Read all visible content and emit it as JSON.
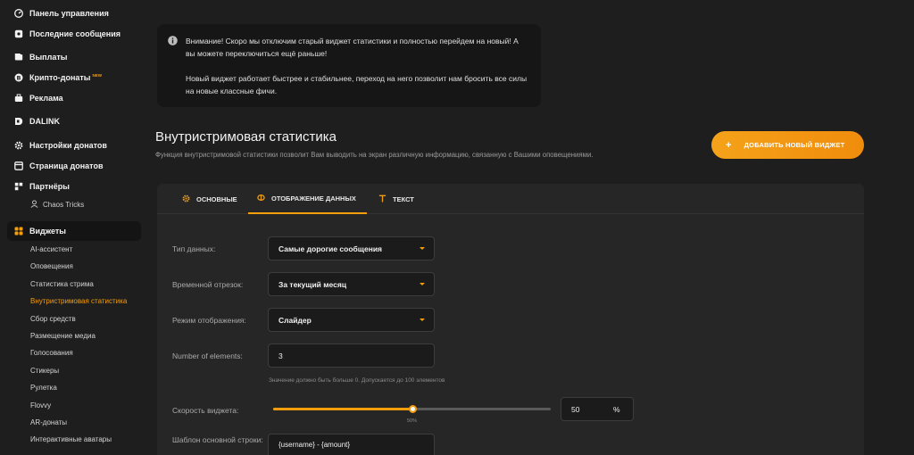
{
  "sidebar": {
    "items": [
      {
        "label": "Панель управления",
        "icon": "dashboard-icon"
      },
      {
        "label": "Последние сообщения",
        "icon": "messages-icon"
      },
      {
        "label": "Выплаты",
        "icon": "wallet-icon"
      },
      {
        "label": "Крипто-донаты",
        "icon": "bitcoin-icon",
        "badge": "NEW"
      },
      {
        "label": "Реклама",
        "icon": "briefcase-icon"
      },
      {
        "label": "DALINK",
        "icon": "dalink-icon"
      },
      {
        "label": "Настройки донатов",
        "icon": "gear-icon"
      },
      {
        "label": "Страница донатов",
        "icon": "page-icon"
      },
      {
        "label": "Партнёры",
        "icon": "partners-icon"
      },
      {
        "label": "Виджеты",
        "icon": "widgets-icon"
      }
    ],
    "partner_sub": "Chaos Tricks",
    "widget_subs": [
      "AI-ассистент",
      "Оповещения",
      "Статистика стрима",
      "Внутристримовая статистика",
      "Сбор средств",
      "Размещение медиа",
      "Голосования",
      "Стикеры",
      "Рулетка",
      "Flovvy",
      "AR-донаты",
      "Интерактивные аватары"
    ],
    "active_sub": "Внутристримовая статистика"
  },
  "notice": {
    "line1": "Внимание! Скоро мы отключим старый виджет статистики и полностью перейдем на новый! А вы можете переключиться ещё раньше!",
    "line2": "Новый виджет работает быстрее и стабильнее, переход на него позволит нам бросить все силы на новые классные фичи."
  },
  "page": {
    "title": "Внутристримовая статистика",
    "description": "Функция внутристримовой статистики позволит Вам выводить на экран различную информацию, связанную с Вашими оповещениями.",
    "add_button": "ДОБАВИТЬ НОВЫЙ ВИДЖЕТ"
  },
  "tabs": [
    {
      "label": "ОСНОВНЫЕ",
      "icon": "gear-icon"
    },
    {
      "label": "ОТОБРАЖЕНИЕ ДАННЫХ",
      "icon": "database-icon",
      "active": true
    },
    {
      "label": "ТЕКСТ",
      "icon": "text-icon"
    }
  ],
  "form": {
    "data_type_label": "Тип данных:",
    "data_type_value": "Самые дорогие сообщения",
    "period_label": "Временной отрезок:",
    "period_value": "За текущий месяц",
    "display_mode_label": "Режим отображения:",
    "display_mode_value": "Слайдер",
    "elements_label": "Number of elements:",
    "elements_value": "3",
    "elements_hint": "Значение должно быть больше 0. Допускается до 100 элементов",
    "speed_label": "Скорость виджета:",
    "speed_value": "50",
    "speed_unit": "%",
    "speed_slider_label": "50%",
    "speed_percent": 50,
    "template_label": "Шаблон основной строки:",
    "template_value": "{username} - {amount}"
  },
  "colors": {
    "accent": "#f59e0b",
    "background": "#1e1e1e",
    "panel": "#262626"
  }
}
